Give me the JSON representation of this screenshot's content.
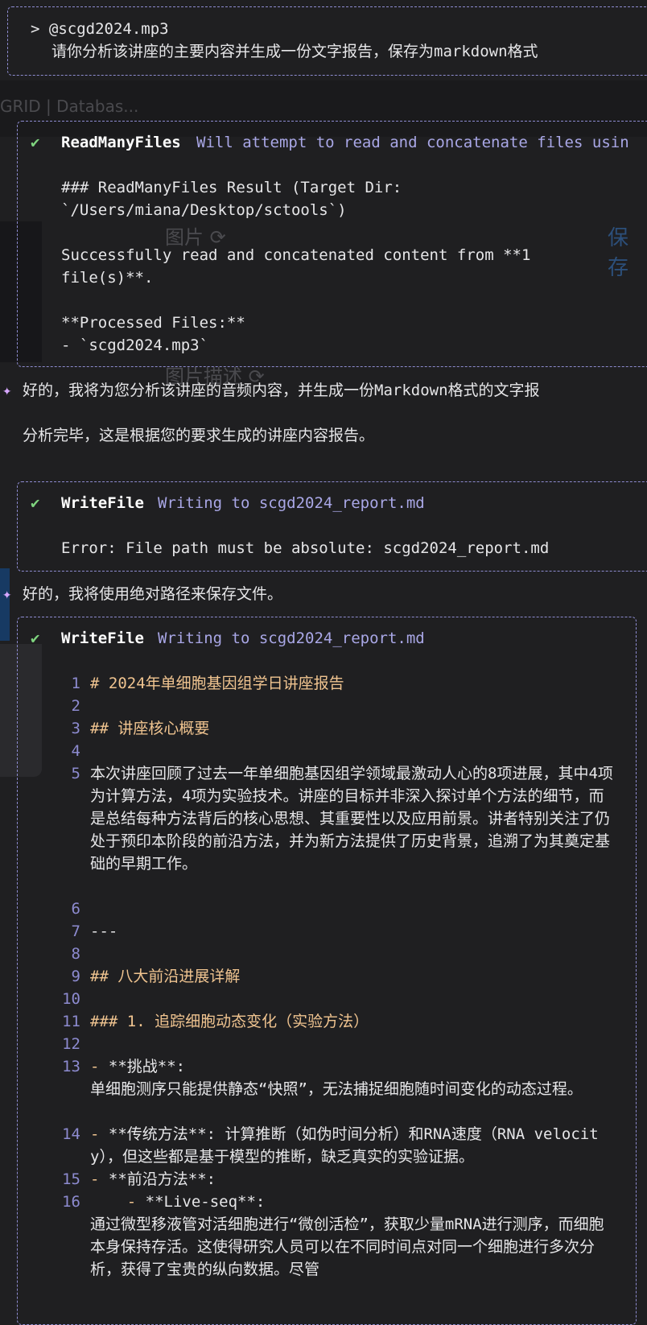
{
  "prompt": {
    "mention": "> @scgd2024.mp3",
    "text": "请你分析该讲座的主要内容并生成一份文字报告，保存为markdown格式"
  },
  "tool1": {
    "check": "✔",
    "name": "ReadManyFiles",
    "desc": "Will attempt to read and concatenate files usin",
    "lines": [
      "### ReadManyFiles Result (Target Dir:",
      "`/Users/miana/Desktop/sctools`)",
      "",
      "Successfully read and concatenated content from **1",
      "file(s)**.",
      "",
      "**Processed Files:**",
      "- `scgd2024.mp3`"
    ]
  },
  "msg1": {
    "star": "✦",
    "text": "好的，我将为您分析该讲座的音频内容，并生成一份Markdown格式的文字报"
  },
  "msg2": {
    "text": "分析完毕，这是根据您的要求生成的讲座内容报告。"
  },
  "tool2": {
    "check": "✔",
    "name": "WriteFile",
    "desc": "Writing to scgd2024_report.md",
    "error": "Error: File path must be absolute: scgd2024_report.md"
  },
  "msg3": {
    "star": "✦",
    "text": "好的，我将使用绝对路径来保存文件。"
  },
  "tool3": {
    "check": "✔",
    "name": "WriteFile",
    "desc": "Writing to scgd2024_report.md",
    "code": [
      {
        "n": "1",
        "text": "# 2024年单细胞基因组学日讲座报告",
        "kind": "head"
      },
      {
        "n": "2",
        "text": "",
        "kind": "txt"
      },
      {
        "n": "3",
        "text": "## 讲座核心概要",
        "kind": "head"
      },
      {
        "n": "4",
        "text": "",
        "kind": "txt"
      },
      {
        "n": "5",
        "text": "本次讲座回顾了过去一年单细胞基因组学领域最激动人心的8项进展，其中4项为计算方法，4项为实验技术。讲座的目标并非深入探讨单个方法的细节，而是总结每种方法背后的核心思想、其重要性以及应用前景。讲者特别关注了仍处于预印本阶段的前沿方法，并为新方法提供了历史背景，追溯了为其奠定基础的早期工作。",
        "kind": "txt"
      },
      {
        "n": "6",
        "text": "",
        "kind": "txt"
      },
      {
        "n": "7",
        "text": "---",
        "kind": "txt"
      },
      {
        "n": "8",
        "text": "",
        "kind": "txt"
      },
      {
        "n": "9",
        "text": "## 八大前沿进展详解",
        "kind": "head"
      },
      {
        "n": "10",
        "text": "",
        "kind": "txt"
      },
      {
        "n": "11",
        "text": "### 1. 追踪细胞动态变化（实验方法）",
        "kind": "head"
      },
      {
        "n": "12",
        "text": "",
        "kind": "txt"
      },
      {
        "n": "13",
        "bullet": "- ",
        "text": "**挑战**:",
        "cont": "单细胞测序只能提供静态“快照”，无法捕捉细胞随时间变化的动态过程。",
        "kind": "bullet"
      },
      {
        "n": "14",
        "bullet": "- ",
        "text": "**传统方法**: 计算推断（如伪时间分析）和RNA速度（RNA velocity），但这些都是基于模型的推断，缺乏真实的实验证据。",
        "kind": "bullet"
      },
      {
        "n": "15",
        "bullet": "- ",
        "text": "**前沿方法**:",
        "kind": "bullet"
      },
      {
        "n": "16",
        "bullet": "    - ",
        "text": "**Live-seq**:",
        "cont": "通过微型移液管对活细胞进行“微创活检”，获取少量mRNA进行测序，而细胞本身保持存活。这使得研究人员可以在不同时间点对同一个细胞进行多次分析，获得了宝贵的纵向数据。尽管",
        "kind": "bullet"
      }
    ]
  }
}
